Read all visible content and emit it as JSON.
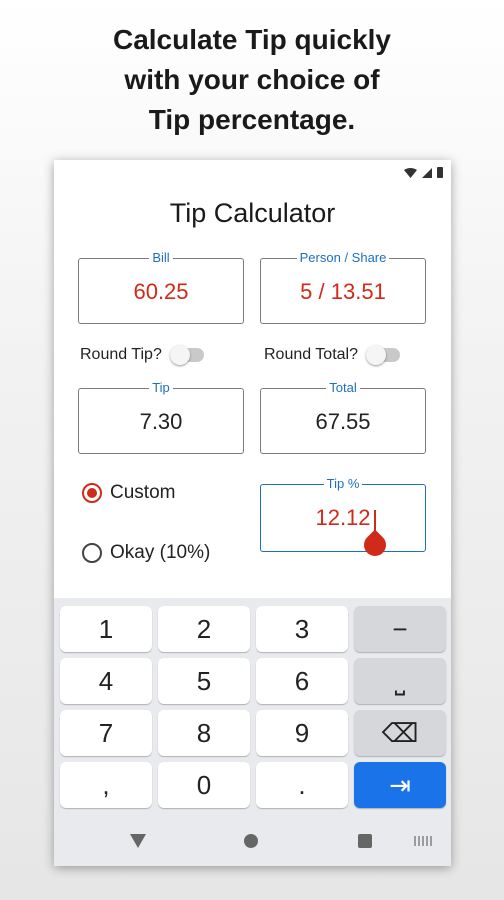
{
  "promo": {
    "line1": "Calculate Tip quickly",
    "line2": "with your choice of",
    "line3": "Tip percentage."
  },
  "app": {
    "title": "Tip Calculator",
    "bill": {
      "label": "Bill",
      "value": "60.25"
    },
    "share": {
      "label": "Person / Share",
      "value": "5 / 13.51"
    },
    "round_tip_label": "Round Tip?",
    "round_total_label": "Round Total?",
    "round_tip_on": false,
    "round_total_on": false,
    "tip": {
      "label": "Tip",
      "value": "7.30"
    },
    "total": {
      "label": "Total",
      "value": "67.55"
    },
    "tip_percent": {
      "label": "Tip %",
      "value": "12.12"
    },
    "options": [
      {
        "label": "Custom",
        "selected": true
      },
      {
        "label": "Okay (10%)",
        "selected": false
      }
    ]
  },
  "keyboard": {
    "keys": [
      "1",
      "2",
      "3",
      "−",
      "4",
      "5",
      "6",
      "⎵",
      "7",
      "8",
      "9",
      "⌫",
      ",",
      "0",
      ".",
      "⇥"
    ]
  },
  "colors": {
    "accent": "#1e6fc0",
    "value_red": "#d02a1a",
    "action_key": "#1a73e8"
  }
}
